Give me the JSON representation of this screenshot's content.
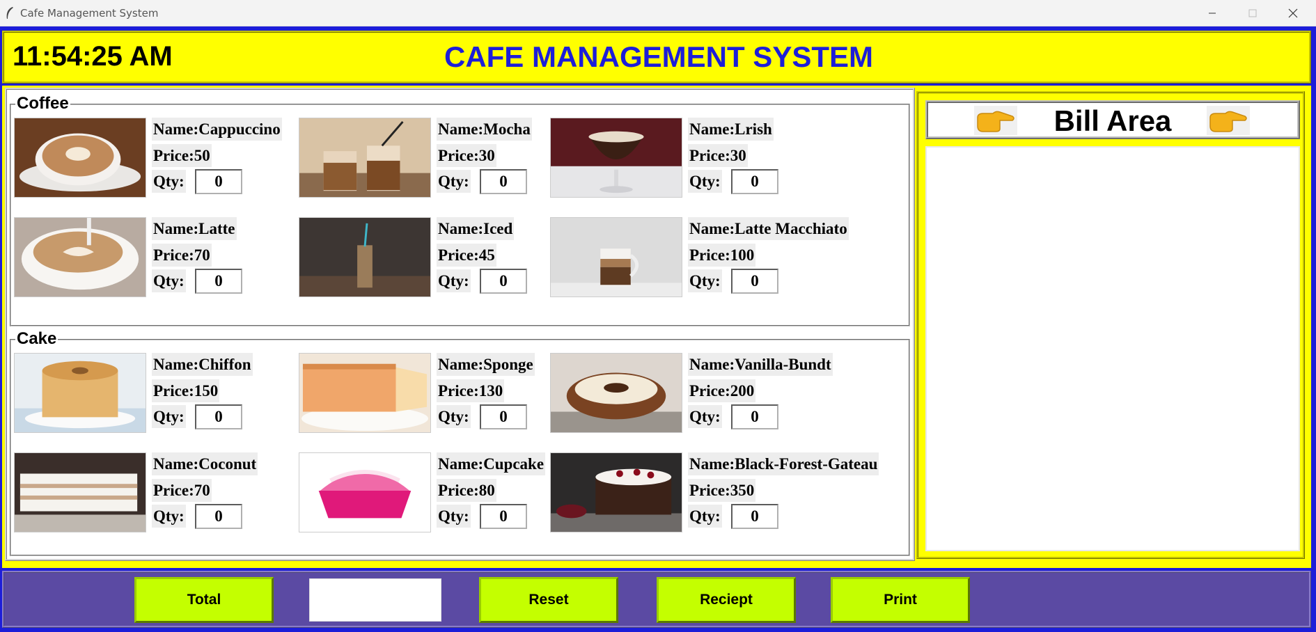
{
  "window": {
    "title": "Cafe Management System"
  },
  "header": {
    "clock": "11:54:25 AM",
    "title": "CAFE MANAGEMENT SYSTEM"
  },
  "sections": {
    "coffee": {
      "label": "Coffee",
      "items": [
        {
          "name": "Name:Cappuccino",
          "price": "Price:50",
          "qty_label": "Qty:",
          "qty": "0"
        },
        {
          "name": "Name:Mocha",
          "price": "Price:30",
          "qty_label": "Qty:",
          "qty": "0"
        },
        {
          "name": "Name:Lrish",
          "price": "Price:30",
          "qty_label": "Qty:",
          "qty": "0"
        },
        {
          "name": "Name:Latte",
          "price": "Price:70",
          "qty_label": "Qty:",
          "qty": "0"
        },
        {
          "name": "Name:Iced",
          "price": "Price:45",
          "qty_label": "Qty:",
          "qty": "0"
        },
        {
          "name": "Name:Latte Macchiato",
          "price": "Price:100",
          "qty_label": "Qty:",
          "qty": "0"
        }
      ]
    },
    "cake": {
      "label": "Cake",
      "items": [
        {
          "name": "Name:Chiffon",
          "price": "Price:150",
          "qty_label": "Qty:",
          "qty": "0"
        },
        {
          "name": "Name:Sponge",
          "price": "Price:130",
          "qty_label": "Qty:",
          "qty": "0"
        },
        {
          "name": "Name:Vanilla-Bundt",
          "price": "Price:200",
          "qty_label": "Qty:",
          "qty": "0"
        },
        {
          "name": "Name:Coconut",
          "price": "Price:70",
          "qty_label": "Qty:",
          "qty": "0"
        },
        {
          "name": "Name:Cupcake",
          "price": "Price:80",
          "qty_label": "Qty:",
          "qty": "0"
        },
        {
          "name": "Name:Black-Forest-Gateau",
          "price": "Price:350",
          "qty_label": "Qty:",
          "qty": "0"
        }
      ]
    }
  },
  "bill": {
    "title": "Bill Area",
    "left_icon": "pointing-hand-right-icon",
    "right_icon": "pointing-hand-right-icon",
    "content": ""
  },
  "footer": {
    "total_label": "Total",
    "total_value": "",
    "reset_label": "Reset",
    "receipt_label": "Reciept",
    "print_label": "Print"
  },
  "colors": {
    "header_bg": "#ffff00",
    "title_text": "#1d1ed8",
    "frame": "#1d1ed8",
    "footer_bg": "#5b4aa3",
    "button_bg": "#c4ff00"
  }
}
